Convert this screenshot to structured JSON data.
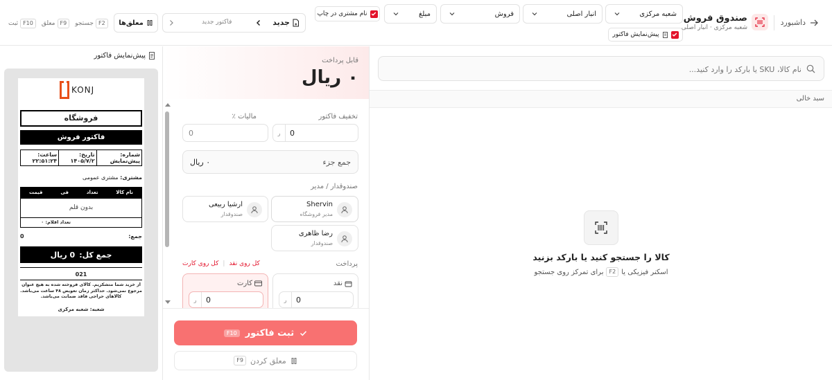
{
  "header": {
    "back_label": "داشبورد",
    "title": "صندوق فروش",
    "subtitle": "شعبه مرکزی · انبار اصلی",
    "branch": "شعبه مرکزی",
    "warehouse": "انبار اصلی",
    "mode": "فروش",
    "amount": "مبلغ",
    "print_customer_name": "نام مشتری در چاپ",
    "invoice_preview_toggle": "پیش‌نمایش فاکتور",
    "new_label": "جدید",
    "new_invoice_label": "فاکتور جدید",
    "held_label": "معلق‌ها",
    "shortcuts": [
      {
        "key": "F2",
        "label": "جستجو"
      },
      {
        "key": "F9",
        "label": "معلق"
      },
      {
        "key": "F10",
        "label": "ثبت"
      }
    ]
  },
  "products": {
    "search_placeholder": "نام کالا، SKU یا بارکد را وارد کنید...",
    "cart_empty": "سبد خالی",
    "empty_title": "کالا را جستجو کنید یا بارکد بزنید",
    "empty_hint_pre": "اسکنر فیزیکی یا",
    "empty_hint_key": "F2",
    "empty_hint_post": "برای تمرکز روی جستجو"
  },
  "payment": {
    "payable_label": "قابل پرداخت",
    "payable_amount": "۰ ریال",
    "discount_label": "تخفیف فاکتور",
    "discount_value": "0",
    "currency_short": "ر",
    "tax_label": "مالیات ٪",
    "tax_value": "0",
    "subtotal_label": "جمع جزء",
    "subtotal_value": "۰ ریال",
    "cashier_section": "صندوقدار / مدیر",
    "users": [
      {
        "name": "Shervin",
        "role": "مدیر فروشگاه"
      },
      {
        "name": "ارشیا ربیعی",
        "role": "صندوقدار"
      },
      {
        "name": "رضا ظاهری",
        "role": "صندوقدار"
      }
    ],
    "payment_section": "پرداخت",
    "all_cash": "کل روی نقد",
    "all_card": "کل روی کارت",
    "cash_label": "نقد",
    "card_label": "کارت",
    "cash_value": "0",
    "card_value": "0",
    "submit_label": "ثبت فاکتور",
    "submit_key": "F10",
    "hold_label": "معلق کردن",
    "hold_key": "F9"
  },
  "preview": {
    "title": "پیش‌نمایش فاکتور",
    "logo_text": "KONJ",
    "store": "فروشگاه",
    "invoice_type": "فاکتور فروش",
    "number_label": "شماره:",
    "number_value": "پیش‌نمایش",
    "date_label": "تاریخ:",
    "date_value": "۱۴۰۵/۷/۲",
    "time_label": "ساعت:",
    "time_value": "۲۲:۵۱:۲۴",
    "customer_label": "مشتری:",
    "customer_value": "مشتری عمومی",
    "columns": [
      "نام کالا",
      "تعداد",
      "فی",
      "قیمت"
    ],
    "no_items": "بدون قلم",
    "item_count": "تعداد اقلام: ۰",
    "sum_label": "جمع:",
    "sum_value": "0",
    "total_label": "جمع کل:",
    "total_value": "0 ریال",
    "code": "021",
    "footer_note": "از خرید شما متشکریم. کالای فروخته شده به هیچ عنوان مرجوع نمی‌شود. حداکثر زمان تعویض ۴۸ ساعت می‌باشد. کالاهای حراجی فاقد ضمانت می‌باشد.",
    "branch_line": "شعبه: شعبه مرکزی"
  },
  "colors": {
    "accent": "#e3132b",
    "submit_bg": "#f87171",
    "payable_bg": "#fff1f1"
  }
}
